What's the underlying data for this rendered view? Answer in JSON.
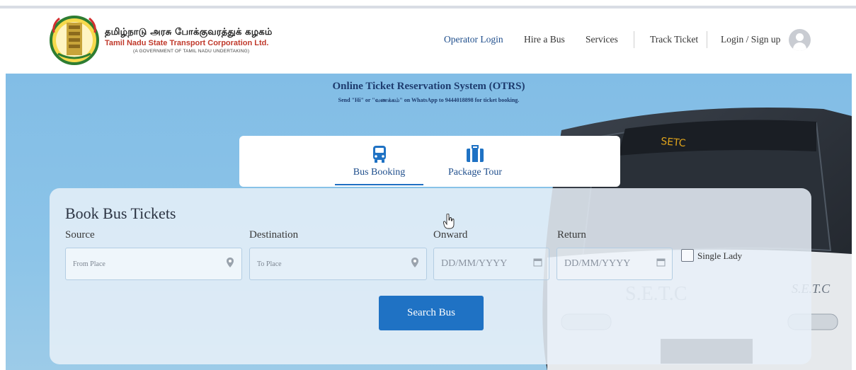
{
  "brand": {
    "tamil_name": "தமிழ்நாடு அரசு போக்குவரத்துக் கழகம்",
    "english_name": "Tamil Nadu State Transport Corporation Ltd.",
    "tagline": "(A GOVERNMENT OF TAMIL NADU UNDERTAKING)",
    "logo_icon": "tamil-nadu-emblem"
  },
  "nav": {
    "operator_login": "Operator Login",
    "hire_a_bus": "Hire a Bus",
    "services": "Services",
    "track_ticket": "Track Ticket",
    "login_signup": "Login / Sign up",
    "avatar_icon": "user-avatar-icon"
  },
  "hero": {
    "title": "Online Ticket Reservation System (OTRS)",
    "subtitle": "Send \"Hi\" or \"வணக்கம்\" on WhatsApp to 9444018898 for ticket booking."
  },
  "tabs": [
    {
      "label": "Bus Booking",
      "icon": "bus-icon",
      "active": true
    },
    {
      "label": "Package Tour",
      "icon": "luggage-icon",
      "active": false
    }
  ],
  "booking": {
    "title": "Book Bus Tickets",
    "source_label": "Source",
    "source_placeholder": "From Place",
    "destination_label": "Destination",
    "destination_placeholder": "To Place",
    "onward_label": "Onward",
    "onward_placeholder": "DD/MM/YYYY",
    "return_label": "Return",
    "return_placeholder": "DD/MM/YYYY",
    "single_lady_label": "Single Lady",
    "single_lady_checked": false,
    "search_button": "Search Bus"
  },
  "colors": {
    "accent": "#1f72c4",
    "hero_bg": "#86c0e7",
    "brand_red": "#c0392b",
    "nav_active": "#1f4e8c"
  }
}
